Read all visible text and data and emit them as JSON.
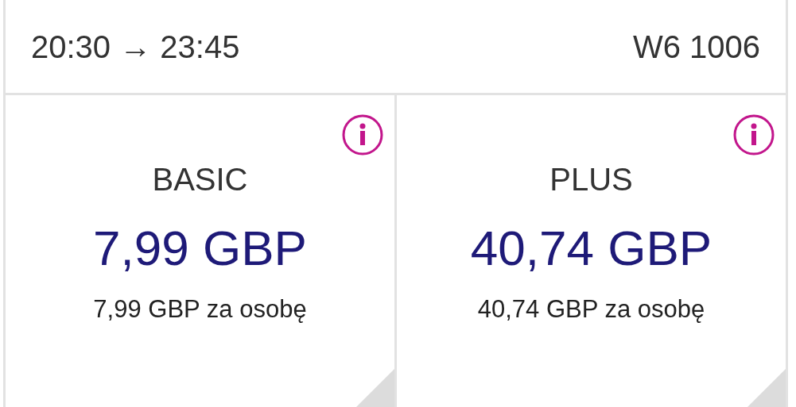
{
  "flight": {
    "times": "20:30 → 23:45",
    "number": "W6 1006"
  },
  "fares": [
    {
      "name": "BASIC",
      "price": "7,99 GBP",
      "per_person": "7,99 GBP za osobę"
    },
    {
      "name": "PLUS",
      "price": "40,74 GBP",
      "per_person": "40,74 GBP za osobę"
    }
  ]
}
